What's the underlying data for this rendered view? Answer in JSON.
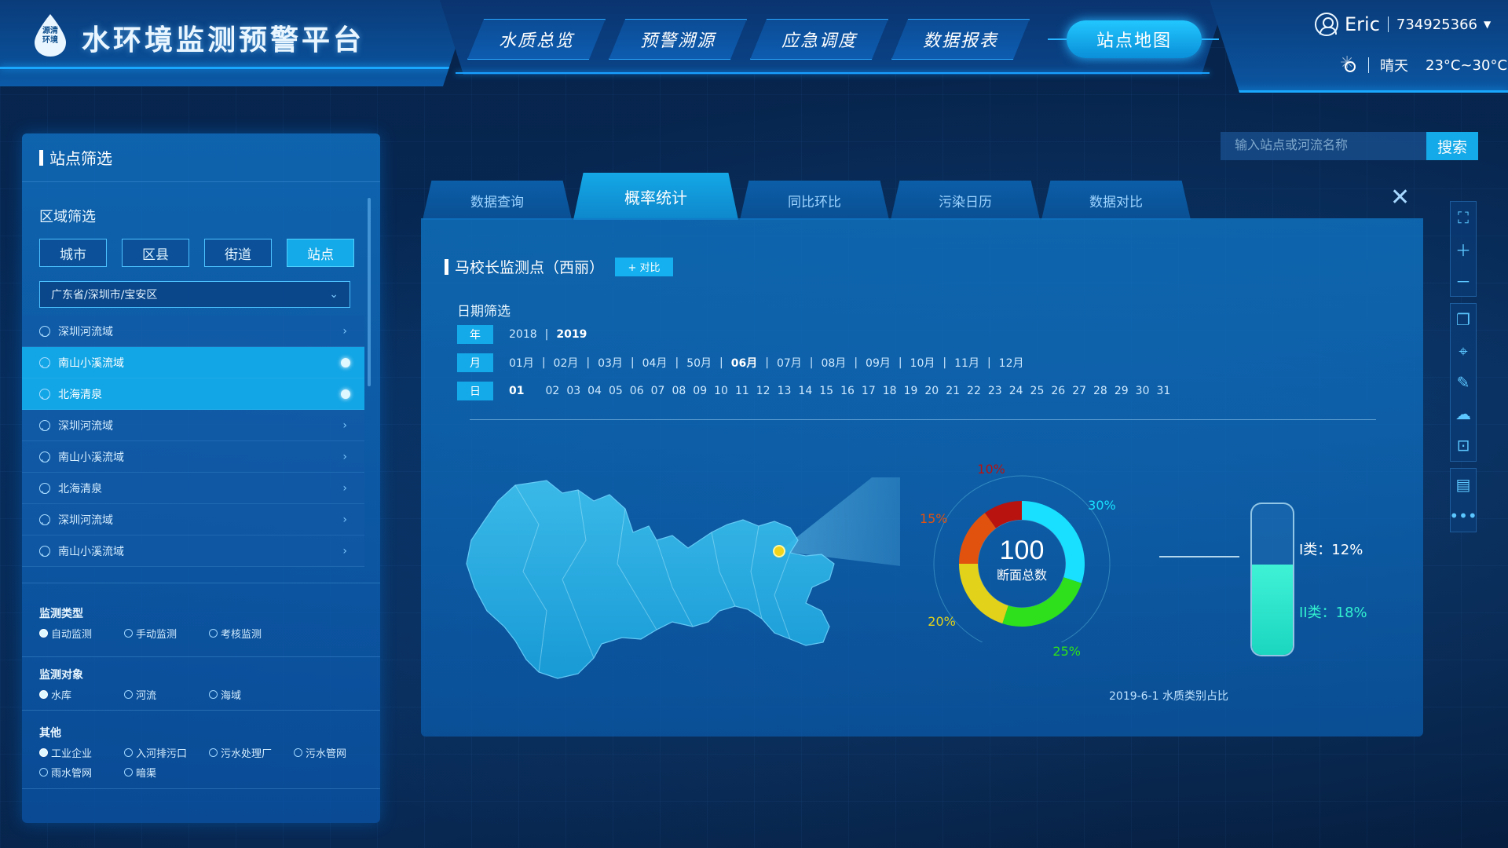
{
  "header": {
    "logo_text": "源清\n环境",
    "title": "水环境监测预警平台",
    "nav": [
      "水质总览",
      "预警溯源",
      "应急调度",
      "数据报表"
    ],
    "nav_active": "站点地图",
    "user": {
      "name": "Eric",
      "id": "734925366"
    },
    "weather": {
      "condition": "晴天",
      "temp": "23°C~30°C"
    }
  },
  "left_panel": {
    "title": "站点筛选",
    "region_title": "区域筛选",
    "region_buttons": [
      "城市",
      "区县",
      "街道",
      "站点"
    ],
    "region_active": "站点",
    "region_select": "广东省/深圳市/宝安区",
    "stations": [
      {
        "name": "深圳河流域",
        "selected": false
      },
      {
        "name": "南山小溪流域",
        "selected": true
      },
      {
        "name": "北海清泉",
        "selected": true
      },
      {
        "name": "深圳河流域",
        "selected": false
      },
      {
        "name": "南山小溪流域",
        "selected": false
      },
      {
        "name": "北海清泉",
        "selected": false
      },
      {
        "name": "深圳河流域",
        "selected": false
      },
      {
        "name": "南山小溪流域",
        "selected": false
      }
    ],
    "monitor_type": {
      "title": "监测类型",
      "options": [
        "自动监测",
        "手动监测",
        "考核监测"
      ],
      "selected": "自动监测"
    },
    "monitor_object": {
      "title": "监测对象",
      "options": [
        "水库",
        "河流",
        "海域"
      ],
      "selected": "水库"
    },
    "other": {
      "title": "其他",
      "options": [
        "工业企业",
        "入河排污口",
        "污水处理厂",
        "污水管网",
        "雨水管网",
        "暗渠"
      ],
      "selected": "工业企业"
    }
  },
  "search": {
    "placeholder": "输入站点或河流名称",
    "button": "搜索"
  },
  "tabs": [
    "数据查询",
    "概率统计",
    "同比环比",
    "污染日历",
    "数据对比"
  ],
  "tab_active": "概率统计",
  "main": {
    "station_name": "马校长监测点（西丽）",
    "compare_button": "+ 对比",
    "date_label": "日期筛选",
    "year_chip": "年",
    "month_chip": "月",
    "day_chip": "日",
    "years": [
      "2018",
      "2019"
    ],
    "year_current": "2019",
    "months": [
      "01月",
      "02月",
      "03月",
      "04月",
      "50月",
      "06月",
      "07月",
      "08月",
      "09月",
      "10月",
      "11月",
      "12月"
    ],
    "month_current": "06月",
    "days": [
      "01",
      "02",
      "03",
      "04",
      "05",
      "06",
      "07",
      "08",
      "09",
      "10",
      "11",
      "12",
      "13",
      "14",
      "15",
      "16",
      "17",
      "18",
      "19",
      "20",
      "21",
      "22",
      "23",
      "24",
      "25",
      "26",
      "27",
      "28",
      "29",
      "30",
      "31"
    ],
    "day_current": "01",
    "caption": "2019-6-1 水质类别占比",
    "class_1": "I类：12%",
    "class_2": "II类：18%",
    "tube_level": 0.6
  },
  "chart_data": {
    "type": "pie",
    "center_value": "100",
    "center_label": "断面总数",
    "slices": [
      {
        "label": "30%",
        "value": 30,
        "color": "#19e0ff"
      },
      {
        "label": "25%",
        "value": 25,
        "color": "#2ee01b"
      },
      {
        "label": "20%",
        "value": 20,
        "color": "#e2d21a"
      },
      {
        "label": "15%",
        "value": 15,
        "color": "#e2520f"
      },
      {
        "label": "10%",
        "value": 10,
        "color": "#b8130f"
      }
    ]
  },
  "colors": {
    "accent": "#14a9e8",
    "highlight": "#32f1cf",
    "station_dot": "#f2d41b"
  }
}
